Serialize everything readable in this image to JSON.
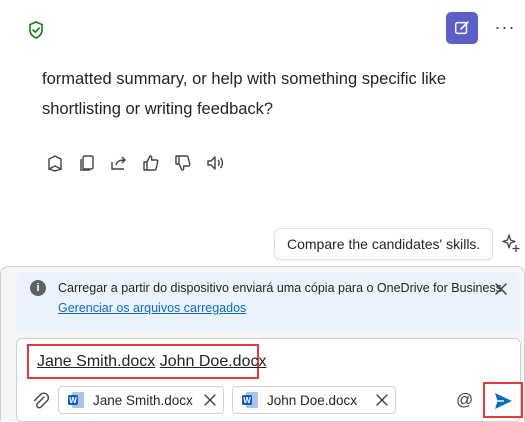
{
  "header": {
    "shield_icon": "shield-check-icon",
    "new_chat_icon": "compose-icon",
    "more_label": "···"
  },
  "message": {
    "clipped_line": "",
    "lines": [
      "formatted summary, or help with something specific like",
      "shortlisting or writing feedback?"
    ],
    "actions": [
      "notebook-icon",
      "copy-icon",
      "share-icon",
      "thumbs-up-icon",
      "thumbs-down-icon",
      "speaker-icon"
    ]
  },
  "suggestion": {
    "label": "Compare the candidates' skills."
  },
  "notice": {
    "text": "Carregar a partir do dispositivo enviará uma cópia para o OneDrive for Business.",
    "link": "Gerenciar os arquivos carregados"
  },
  "composer": {
    "input_file_1": "Jane Smith.docx",
    "input_file_2": "John Doe.docx",
    "attachments": [
      {
        "name": "Jane Smith.docx",
        "icon": "word-doc-icon"
      },
      {
        "name": "John Doe.docx",
        "icon": "word-doc-icon"
      }
    ],
    "at_label": "@",
    "send_icon": "send-icon"
  },
  "colors": {
    "accent": "#5b5fc7",
    "highlight": "#e03a3a",
    "link": "#0f6cbd",
    "send": "#0f6cbd",
    "shield": "#107c10"
  }
}
